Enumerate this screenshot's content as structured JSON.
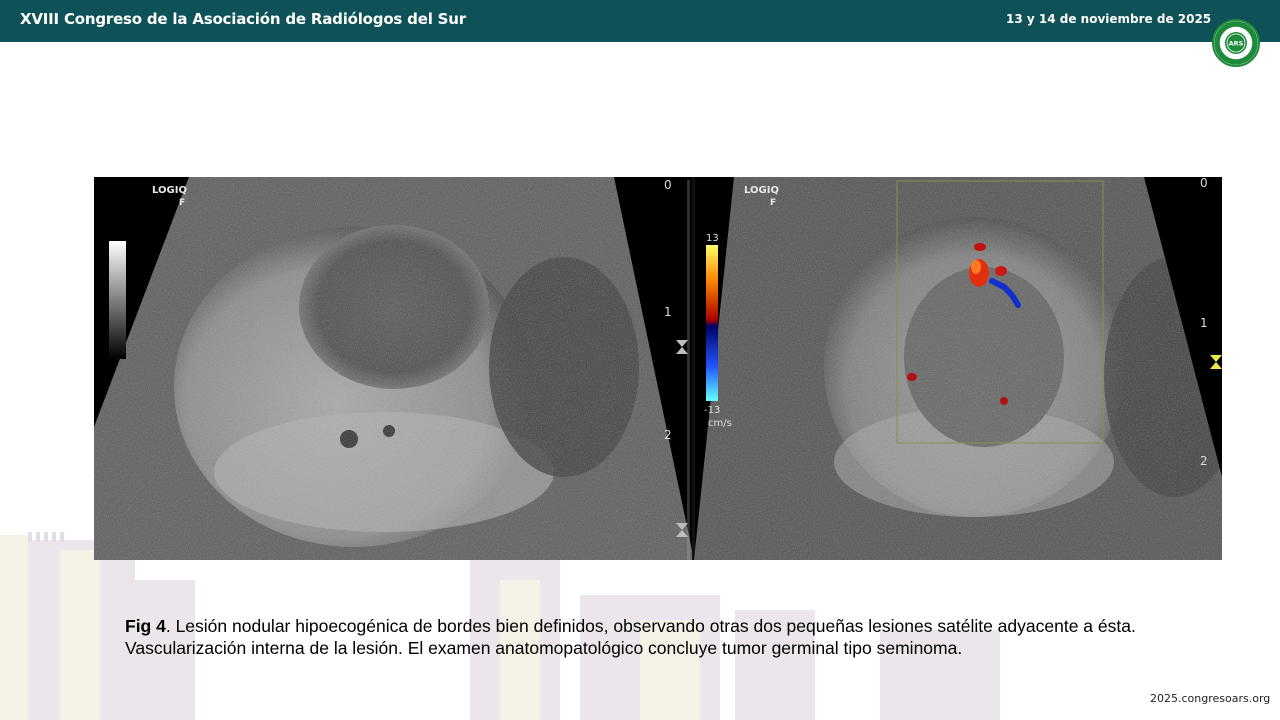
{
  "header": {
    "title": "XVIII Congreso de la Asociación de Radiólogos del Sur",
    "date": "13 y 14 de noviembre de 2025"
  },
  "logo": {
    "initials": "ARS",
    "ring_text": "ASOCIACIÓN RADIÓLOGOS SUR"
  },
  "images": {
    "left": {
      "brand": "LOGIQ",
      "mode": "F",
      "depth_marks": [
        "0",
        "1",
        "2"
      ]
    },
    "right": {
      "brand": "LOGIQ",
      "mode": "F",
      "depth_marks": [
        "0",
        "1",
        "2"
      ],
      "color_scale": {
        "max": "13",
        "min": "-13",
        "unit": "cm/s"
      }
    }
  },
  "caption": {
    "label": "Fig 4",
    "text": ". Lesión nodular hipoecogénica de bordes bien definidos, observando otras dos pequeñas lesiones satélite adyacente a ésta. Vascularización interna de la lesión. El examen anatomopatológico concluye tumor germinal tipo seminoma."
  },
  "footer": {
    "url": "2025.congresoars.org"
  },
  "colors": {
    "header_bg": "#0e5257",
    "logo_green": "#1e8a3c"
  }
}
